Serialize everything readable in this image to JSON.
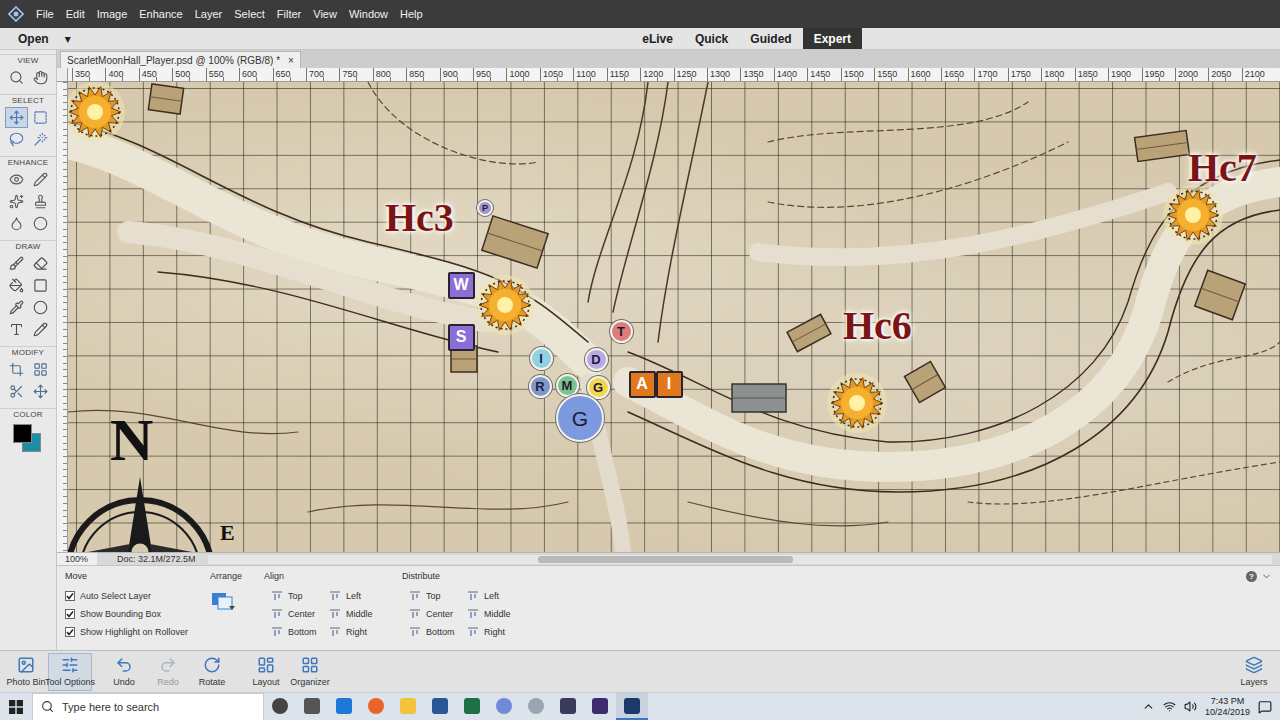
{
  "menu": [
    "File",
    "Edit",
    "Image",
    "Enhance",
    "Layer",
    "Select",
    "Filter",
    "View",
    "Window",
    "Help"
  ],
  "open_button": {
    "label": "Open",
    "arrow": "▾"
  },
  "mode_tabs": [
    {
      "label": "eLive",
      "selected": false
    },
    {
      "label": "Quick",
      "selected": false
    },
    {
      "label": "Guided",
      "selected": false
    },
    {
      "label": "Expert",
      "selected": true
    }
  ],
  "document_tab": {
    "title": "ScarletMoonHall_Player.psd @ 100% (RGB/8) *",
    "close": "×"
  },
  "toolbox": {
    "sections": [
      {
        "label": "VIEW",
        "tools": [
          {
            "selected": false
          },
          {
            "selected": false
          }
        ]
      },
      {
        "label": "SELECT",
        "tools": [
          {
            "selected": true
          },
          {
            "selected": false
          },
          {
            "selected": false
          },
          {
            "selected": false
          }
        ]
      },
      {
        "label": "ENHANCE",
        "tools": [
          {
            "selected": false
          },
          {
            "selected": false
          },
          {
            "selected": false
          },
          {
            "selected": false
          },
          {
            "selected": false
          },
          {
            "selected": false
          }
        ]
      },
      {
        "label": "DRAW",
        "tools": [
          {
            "selected": false
          },
          {
            "selected": false
          },
          {
            "selected": false
          },
          {
            "selected": false
          },
          {
            "selected": false
          },
          {
            "selected": false
          },
          {
            "selected": false
          },
          {
            "selected": false
          }
        ]
      },
      {
        "label": "MODIFY",
        "tools": [
          {
            "selected": false
          },
          {
            "selected": false
          },
          {
            "selected": false
          },
          {
            "selected": false
          }
        ]
      }
    ],
    "color": {
      "label": "COLOR",
      "foreground": "#000000",
      "background": "#1b8fa6"
    }
  },
  "ruler": [
    "350",
    "400",
    "450",
    "500",
    "550",
    "600",
    "650",
    "700",
    "750",
    "800",
    "850",
    "900",
    "950",
    "1000",
    "1050",
    "1100",
    "1150",
    "1200",
    "1250",
    "1300",
    "1350",
    "1400",
    "1450",
    "1500",
    "1550",
    "1600",
    "1650",
    "1700",
    "1750",
    "1800",
    "1850",
    "1900",
    "1950",
    "2000",
    "2050",
    "2100"
  ],
  "map": {
    "labels": [
      "Hc3",
      "Hc6",
      "Hc7"
    ],
    "compass": [
      "N",
      "E"
    ],
    "tokens": [
      {
        "text": "P",
        "kind": "tiny",
        "color": "#a395cf"
      },
      {
        "text": "W",
        "kind": "square",
        "color": "#8b6fd6"
      },
      {
        "text": "S",
        "kind": "square",
        "color": "#8b6fd6"
      },
      {
        "text": "I",
        "kind": "circle",
        "color": "#8fd3e3"
      },
      {
        "text": "D",
        "kind": "circle",
        "color": "#bba9e6"
      },
      {
        "text": "T",
        "kind": "circle",
        "color": "#e07b7b"
      },
      {
        "text": "R",
        "kind": "circle",
        "color": "#8197cc"
      },
      {
        "text": "M",
        "kind": "circle",
        "color": "#7cc48b"
      },
      {
        "text": "G",
        "kind": "circle",
        "color": "#f0d84a"
      },
      {
        "text": "A",
        "kind": "square",
        "color": "#e0781c"
      },
      {
        "text": "I",
        "kind": "square",
        "color": "#e0781c"
      },
      {
        "text": "G",
        "kind": "large",
        "color": "#7d9ae0"
      }
    ]
  },
  "status": {
    "zoom": "100%",
    "doc": "Doc: 32.1M/272.5M",
    "scrollbar": {
      "position": 0.31,
      "level": 0.24
    }
  },
  "tool_options": {
    "tool": "Move",
    "checkboxes": [
      {
        "label": "Auto Select Layer",
        "checked": true
      },
      {
        "label": "Show Bounding Box",
        "checked": true
      },
      {
        "label": "Show Highlight on Rollover",
        "checked": true
      }
    ],
    "arrange": "Arrange",
    "align": {
      "label": "Align",
      "items": [
        "Top",
        "Left",
        "Center",
        "Middle",
        "Bottom",
        "Right"
      ]
    },
    "distribute": {
      "label": "Distribute",
      "items": [
        "Top",
        "Left",
        "Center",
        "Middle",
        "Bottom",
        "Right"
      ]
    },
    "help": "?"
  },
  "bottom_bar": {
    "items": [
      {
        "label": "Photo Bin",
        "selected": false,
        "disabled": false
      },
      {
        "label": "Tool Options",
        "selected": true,
        "disabled": false
      },
      {
        "label": "Undo",
        "selected": false,
        "disabled": false
      },
      {
        "label": "Redo",
        "selected": false,
        "disabled": true
      },
      {
        "label": "Rotate",
        "selected": false,
        "disabled": false
      },
      {
        "label": "Layout",
        "selected": false,
        "disabled": false
      },
      {
        "label": "Organizer",
        "selected": false,
        "disabled": false
      }
    ],
    "layers": "Layers"
  },
  "taskbar": {
    "search_placeholder": "Type here to search",
    "apps": [
      {
        "selected": false
      },
      {
        "selected": false
      },
      {
        "selected": false
      },
      {
        "selected": false
      },
      {
        "selected": false
      },
      {
        "selected": false
      },
      {
        "selected": false
      },
      {
        "selected": false
      },
      {
        "selected": false
      },
      {
        "selected": false
      },
      {
        "selected": false
      },
      {
        "selected": true
      }
    ],
    "time": "7:43 PM",
    "date": "10/24/2019"
  }
}
